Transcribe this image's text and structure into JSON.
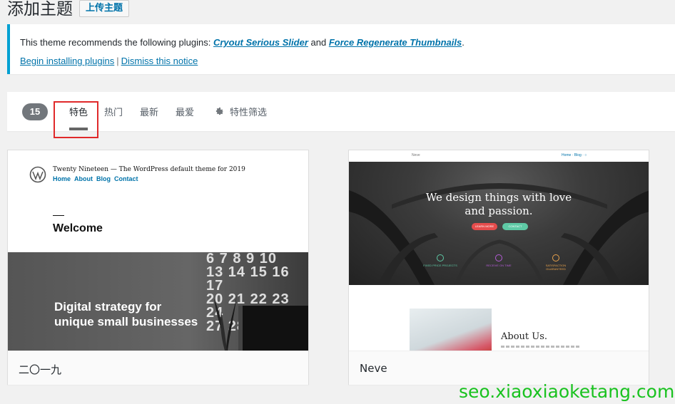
{
  "header": {
    "title": "添加主题",
    "upload_label": "上传主题"
  },
  "notice": {
    "text_before": "This theme recommends the following plugins: ",
    "plugin1": "Cryout Serious Slider",
    "text_and": " and ",
    "plugin2": "Force Regenerate Thumbnails",
    "text_end": ".",
    "begin_link": "Begin installing plugins",
    "separator": "|",
    "dismiss_link": "Dismiss this notice"
  },
  "filter": {
    "count": "15",
    "tabs": [
      {
        "label": "特色",
        "active": true
      },
      {
        "label": "热门"
      },
      {
        "label": "最新"
      },
      {
        "label": "最爱"
      }
    ],
    "feature_filter": "特性筛选",
    "highlight_color": "#e0292a"
  },
  "themes": [
    {
      "name": "二〇一九",
      "preview": {
        "site_title": "Twenty Nineteen",
        "tagline": "— The WordPress default theme for 2019",
        "nav": [
          "Home",
          "About",
          "Blog",
          "Contact"
        ],
        "dash": "—",
        "welcome": "Welcome",
        "hero_line1": "Digital strategy for",
        "hero_line2": "unique small businesses",
        "calendar": [
          "6 7 8 9 10",
          "13 14 15 16 17",
          "20 21 22 23 24",
          "27 28"
        ]
      }
    },
    {
      "name": "Neve",
      "preview": {
        "brand": "Neve",
        "nav": "Home · Blog · ○",
        "headline1": "We design things with love",
        "headline2": "and passion.",
        "button1": "LEARN MORE",
        "button2": "CONTACT",
        "features": [
          "FIXED PRICE PROJECTS",
          "RECEIVE ON TIME",
          "SATISFACTION GUARANTEED"
        ],
        "about_title": "About Us."
      }
    }
  ],
  "watermark": "seo.xiaoxiaoketang.com",
  "colors": {
    "accent": "#0073aa",
    "notice_border": "#00a0d2",
    "watermark": "#19c21f"
  }
}
